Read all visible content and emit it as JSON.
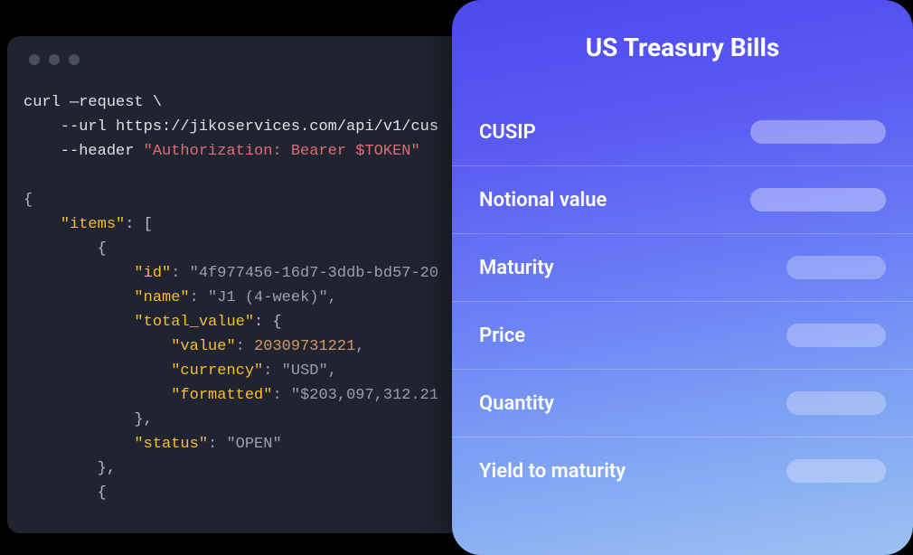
{
  "terminal": {
    "code_lines": [
      {
        "segments": [
          {
            "t": "curl —request \\",
            "c": "tok-cmd"
          }
        ]
      },
      {
        "segments": [
          {
            "t": "    --url https://jikoservices.com/api/v1/cus",
            "c": "tok-cmd"
          }
        ]
      },
      {
        "segments": [
          {
            "t": "    --header ",
            "c": "tok-cmd"
          },
          {
            "t": "\"Authorization: Bearer $TOKEN\"",
            "c": "tok-str"
          }
        ]
      },
      {
        "segments": [
          {
            "t": "",
            "c": "tok-cmd"
          }
        ]
      },
      {
        "segments": [
          {
            "t": "{",
            "c": "tok-brace"
          }
        ]
      },
      {
        "segments": [
          {
            "t": "    ",
            "c": "tok-cmd"
          },
          {
            "t": "\"items\"",
            "c": "tok-key"
          },
          {
            "t": ": [",
            "c": "tok-brace"
          }
        ]
      },
      {
        "segments": [
          {
            "t": "        {",
            "c": "tok-brace"
          }
        ]
      },
      {
        "segments": [
          {
            "t": "            ",
            "c": "tok-cmd"
          },
          {
            "t": "\"id\"",
            "c": "tok-key"
          },
          {
            "t": ": ",
            "c": "tok-dim"
          },
          {
            "t": "\"4f977456-16d7-3ddb-bd57-20",
            "c": "tok-strv"
          }
        ]
      },
      {
        "segments": [
          {
            "t": "            ",
            "c": "tok-cmd"
          },
          {
            "t": "\"name\"",
            "c": "tok-key"
          },
          {
            "t": ": ",
            "c": "tok-dim"
          },
          {
            "t": "\"J1 (4-week)\"",
            "c": "tok-strv"
          },
          {
            "t": ",",
            "c": "tok-dim"
          }
        ]
      },
      {
        "segments": [
          {
            "t": "            ",
            "c": "tok-cmd"
          },
          {
            "t": "\"total_value\"",
            "c": "tok-key"
          },
          {
            "t": ": {",
            "c": "tok-brace"
          }
        ]
      },
      {
        "segments": [
          {
            "t": "                ",
            "c": "tok-cmd"
          },
          {
            "t": "\"value\"",
            "c": "tok-key"
          },
          {
            "t": ": ",
            "c": "tok-dim"
          },
          {
            "t": "20309731221",
            "c": "tok-num"
          },
          {
            "t": ",",
            "c": "tok-dim"
          }
        ]
      },
      {
        "segments": [
          {
            "t": "                ",
            "c": "tok-cmd"
          },
          {
            "t": "\"currency\"",
            "c": "tok-key"
          },
          {
            "t": ": ",
            "c": "tok-dim"
          },
          {
            "t": "\"USD\"",
            "c": "tok-strv"
          },
          {
            "t": ",",
            "c": "tok-dim"
          }
        ]
      },
      {
        "segments": [
          {
            "t": "                ",
            "c": "tok-cmd"
          },
          {
            "t": "\"formatted\"",
            "c": "tok-key"
          },
          {
            "t": ": ",
            "c": "tok-dim"
          },
          {
            "t": "\"$203,097,312.21",
            "c": "tok-strv"
          }
        ]
      },
      {
        "segments": [
          {
            "t": "            },",
            "c": "tok-brace"
          }
        ]
      },
      {
        "segments": [
          {
            "t": "            ",
            "c": "tok-cmd"
          },
          {
            "t": "\"status\"",
            "c": "tok-key"
          },
          {
            "t": ": ",
            "c": "tok-dim"
          },
          {
            "t": "\"OPEN\"",
            "c": "tok-strv"
          }
        ]
      },
      {
        "segments": [
          {
            "t": "        },",
            "c": "tok-brace"
          }
        ]
      },
      {
        "segments": [
          {
            "t": "        {",
            "c": "tok-brace"
          }
        ]
      }
    ]
  },
  "card": {
    "title": "US Treasury Bills",
    "rows": [
      {
        "label": "CUSIP"
      },
      {
        "label": "Notional value"
      },
      {
        "label": "Maturity"
      },
      {
        "label": "Price"
      },
      {
        "label": "Quantity"
      },
      {
        "label": "Yield to maturity"
      }
    ]
  }
}
